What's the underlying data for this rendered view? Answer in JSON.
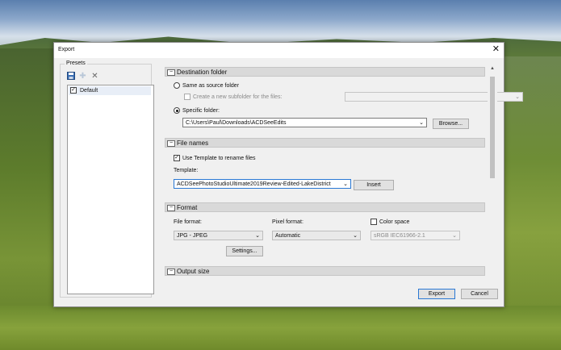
{
  "window": {
    "title": "Export",
    "close_glyph": "✕"
  },
  "presets": {
    "group_label": "Presets",
    "items": [
      {
        "label": "Default",
        "checked": true
      }
    ]
  },
  "destination": {
    "header": "Destination folder",
    "same_as_source_label": "Same as source folder",
    "create_subfolder_label": "Create a new subfolder for the files:",
    "specific_folder_label": "Specific folder:",
    "folder_path": "C:\\Users\\Paul\\Downloads\\ACDSeeEdits",
    "browse_label": "Browse..."
  },
  "file_names": {
    "header": "File names",
    "use_template_label": "Use Template to rename files",
    "template_label": "Template:",
    "template_value": "ACDSeePhotoStudioUltimate2019Review-Edited-LakeDistrict",
    "insert_label": "Insert"
  },
  "format": {
    "header": "Format",
    "file_format_label": "File format:",
    "file_format_value": "JPG - JPEG",
    "pixel_format_label": "Pixel format:",
    "pixel_format_value": "Automatic",
    "color_space_label": "Color space",
    "color_space_value": "sRGB IEC61966-2.1",
    "settings_label": "Settings..."
  },
  "output_size": {
    "header": "Output size"
  },
  "footer": {
    "export_label": "Export",
    "cancel_label": "Cancel"
  },
  "colors": {
    "accent": "#2a78d4",
    "dialog_bg": "#f0f0f0",
    "section_bg": "#d9d9d9"
  }
}
